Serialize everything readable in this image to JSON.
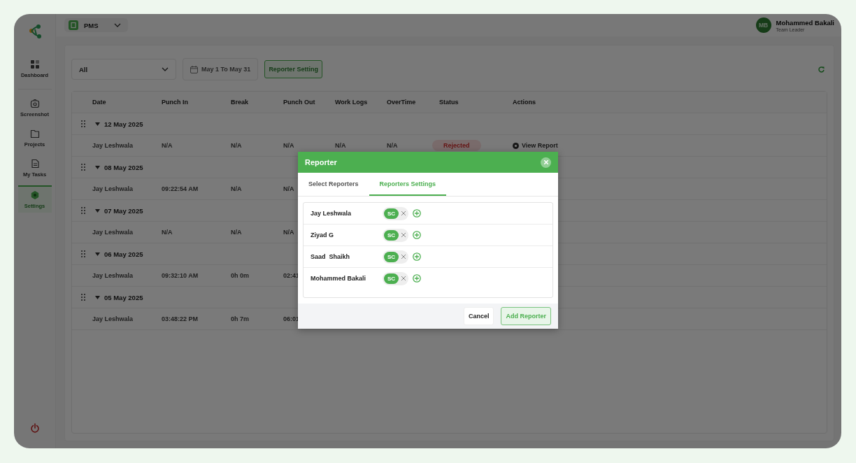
{
  "app": {
    "name": "PMS"
  },
  "sidebar": {
    "items": [
      {
        "label": "Dashboard",
        "kind": "dashboard",
        "selected": false
      },
      {
        "label": "Screenshot",
        "kind": "screenshot",
        "selected": false
      },
      {
        "label": "Projects",
        "kind": "projects",
        "selected": false
      },
      {
        "label": "My Tasks",
        "kind": "tasks",
        "selected": false
      },
      {
        "label": "Settings",
        "kind": "settings",
        "selected": true
      }
    ]
  },
  "user": {
    "initials": "MB",
    "name": "Mohammed Bakali",
    "role": "Team Leader"
  },
  "filters": {
    "status_select": "All",
    "date_range": "May 1 To May 31",
    "reporter_button": "Reporter Setting"
  },
  "table": {
    "columns": [
      "Date",
      "Punch In",
      "Break",
      "Punch Out",
      "Work Logs",
      "OverTime",
      "Status",
      "Actions"
    ],
    "groups": [
      {
        "date": "12 May 2025",
        "expanded": true,
        "rows": [
          {
            "cells": [
              {
                "kind": "text",
                "text": "Jay Leshwala"
              },
              {
                "kind": "text",
                "text": "N/A"
              },
              {
                "kind": "text",
                "text": "N/A"
              },
              {
                "kind": "text",
                "text": "N/A"
              },
              {
                "kind": "text",
                "text": "N/A"
              },
              {
                "kind": "text",
                "text": "N/A"
              },
              {
                "kind": "status",
                "text": "Rejected"
              },
              {
                "kind": "action",
                "text": "View Report"
              }
            ]
          }
        ]
      },
      {
        "date": "08 May 2025",
        "expanded": true,
        "rows": [
          {
            "cells": [
              {
                "kind": "text",
                "text": "Jay Leshwala"
              },
              {
                "kind": "text",
                "text": "09:22:54 AM"
              },
              {
                "kind": "text",
                "text": "N/A"
              },
              {
                "kind": "text",
                "text": "N/A"
              }
            ]
          }
        ]
      },
      {
        "date": "07 May 2025",
        "expanded": true,
        "rows": [
          {
            "cells": [
              {
                "kind": "text",
                "text": "Jay Leshwala"
              },
              {
                "kind": "text",
                "text": "N/A"
              },
              {
                "kind": "text",
                "text": "N/A"
              },
              {
                "kind": "text",
                "text": "N/A"
              }
            ]
          }
        ]
      },
      {
        "date": "06 May 2025",
        "expanded": true,
        "rows": [
          {
            "cells": [
              {
                "kind": "text",
                "text": "Jay Leshwala"
              },
              {
                "kind": "text",
                "text": "09:32:10 AM"
              },
              {
                "kind": "text",
                "text": "0h 0m"
              },
              {
                "kind": "text",
                "text": "02:41"
              }
            ]
          }
        ]
      },
      {
        "date": "05 May 2025",
        "expanded": true,
        "rows": [
          {
            "cells": [
              {
                "kind": "text",
                "text": "Jay Leshwala"
              },
              {
                "kind": "text",
                "text": "03:48:22 PM"
              },
              {
                "kind": "text",
                "text": "0h 7m"
              },
              {
                "kind": "text",
                "text": "06:01"
              }
            ]
          }
        ]
      }
    ]
  },
  "modal": {
    "title": "Reporter",
    "tabs": [
      {
        "label": "Select Reporters",
        "selected": false
      },
      {
        "label": "Reporters Settings",
        "selected": true
      }
    ],
    "reporters": [
      {
        "name": "Jay Leshwala",
        "tags": [
          "SC"
        ]
      },
      {
        "name": "Ziyad G",
        "tags": [
          "SC"
        ]
      },
      {
        "name": "Saad  Shaikh",
        "tags": [
          "SC"
        ]
      },
      {
        "name": "Mohammed Bakali",
        "tags": [
          "SC"
        ]
      }
    ],
    "buttons": [
      {
        "label": "Cancel",
        "kind": "secondary"
      },
      {
        "label": "Add Reporter",
        "kind": "primary"
      }
    ]
  }
}
